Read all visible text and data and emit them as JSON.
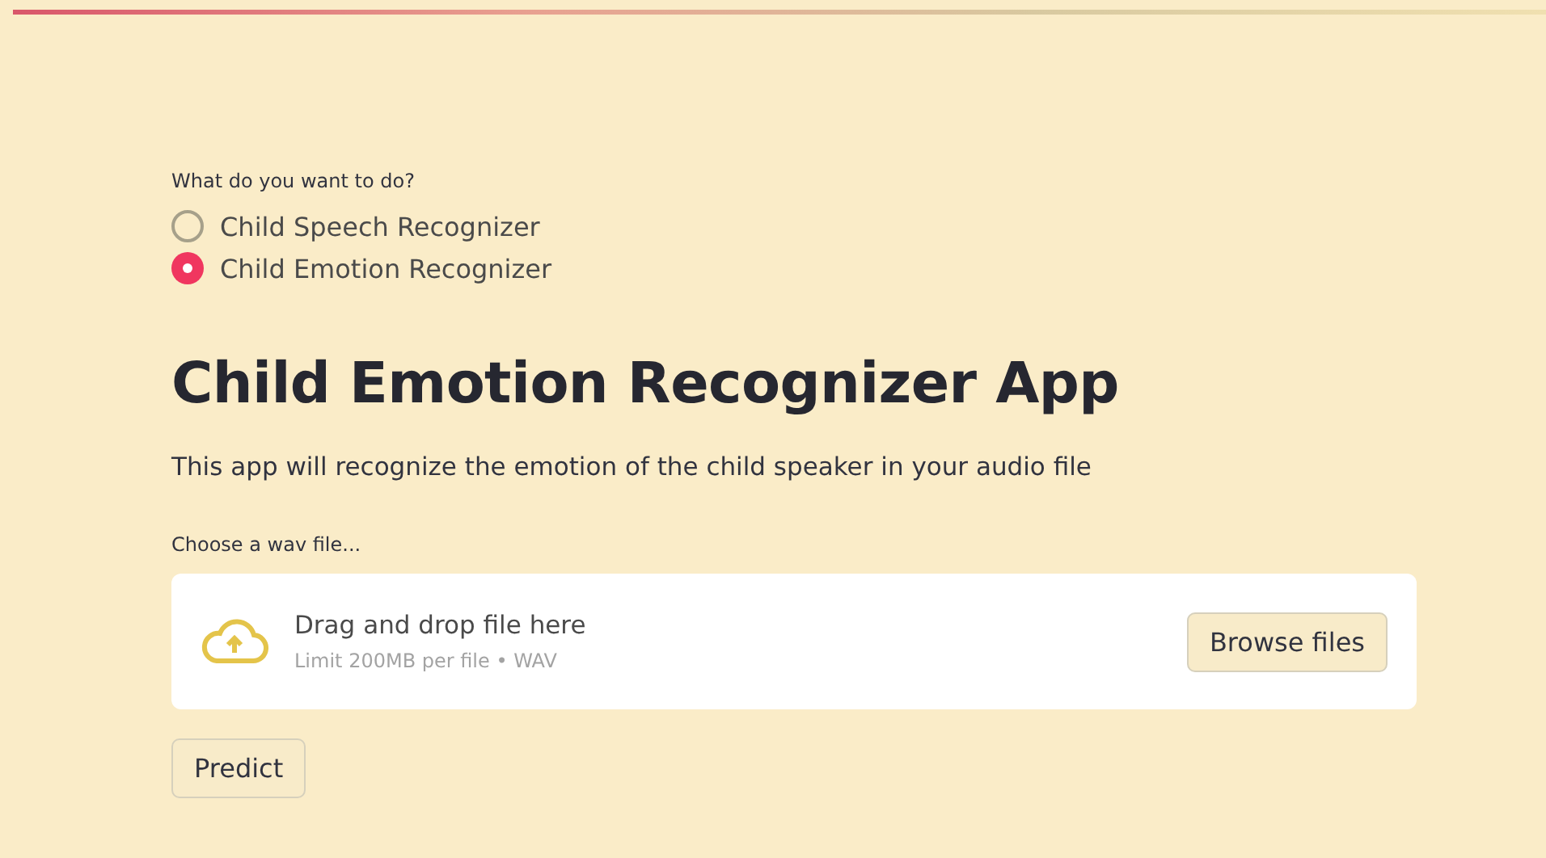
{
  "radio_group": {
    "label": "What do you want to do?",
    "options": [
      {
        "label": "Child Speech Recognizer",
        "selected": false
      },
      {
        "label": "Child Emotion Recognizer",
        "selected": true
      }
    ]
  },
  "title": "Child Emotion Recognizer App",
  "description": "This app will recognize the emotion of the child speaker in your audio file",
  "file_uploader": {
    "label": "Choose a wav file...",
    "instruction": "Drag and drop file here",
    "limit": "Limit 200MB per file • WAV",
    "button": "Browse files"
  },
  "predict_button": "Predict"
}
